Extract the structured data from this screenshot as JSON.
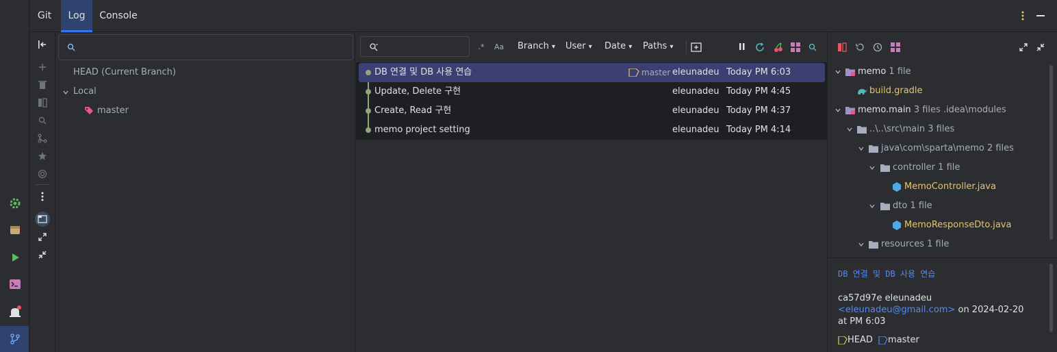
{
  "tabs": [
    {
      "label": "Git"
    },
    {
      "label": "Log"
    },
    {
      "label": "Console"
    }
  ],
  "branches": {
    "head": "HEAD (Current Branch)",
    "local_label": "Local",
    "local_branches": [
      "master"
    ]
  },
  "log": {
    "filters": {
      "branch": "Branch",
      "user": "User",
      "date": "Date",
      "paths": "Paths",
      "regex_label": ".*",
      "case_label": "Aa"
    },
    "commits": [
      {
        "message": "DB 연결 및 DB 사용 연습",
        "tag": "master",
        "author": "eleunadeu",
        "date": "Today PM 6:03"
      },
      {
        "message": "Update, Delete 구현",
        "tag": "",
        "author": "eleunadeu",
        "date": "Today PM 4:45"
      },
      {
        "message": "Create, Read 구현",
        "tag": "",
        "author": "eleunadeu",
        "date": "Today PM 4:37"
      },
      {
        "message": "memo project setting",
        "tag": "",
        "author": "eleunadeu",
        "date": "Today PM 4:14"
      }
    ]
  },
  "changes": {
    "memo_module": {
      "name": "memo",
      "count": "1 file"
    },
    "build_gradle": "build.gradle",
    "memo_main": {
      "name": "memo.main",
      "count": "3 files",
      "path": ".idea\\modules"
    },
    "src_main": {
      "name": "..\\..\\src\\main",
      "count": "3 files"
    },
    "java_pkg": {
      "name": "java\\com\\sparta\\memo",
      "count": "2 files"
    },
    "controller": {
      "name": "controller",
      "count": "1 file"
    },
    "memo_controller": "MemoController.java",
    "dto": {
      "name": "dto",
      "count": "1 file"
    },
    "memo_response_dto": "MemoResponseDto.java",
    "resources": {
      "name": "resources",
      "count": "1 file"
    }
  },
  "details": {
    "title": "DB 연결 및 DB 사용 연습",
    "hash_author": "ca57d97e eleunadeu",
    "email": "<eleunadeu@gmail.com>",
    "on_date": "on 2024-02-20",
    "at_time": "at PM 6:03",
    "ref_head": "HEAD",
    "ref_master": "master"
  },
  "colors": {
    "accent": "#3574f0",
    "selected_row": "#3c3f71",
    "graph_line": "#8fa87a",
    "file_yellow": "#e8c46a",
    "link": "#548af7"
  }
}
